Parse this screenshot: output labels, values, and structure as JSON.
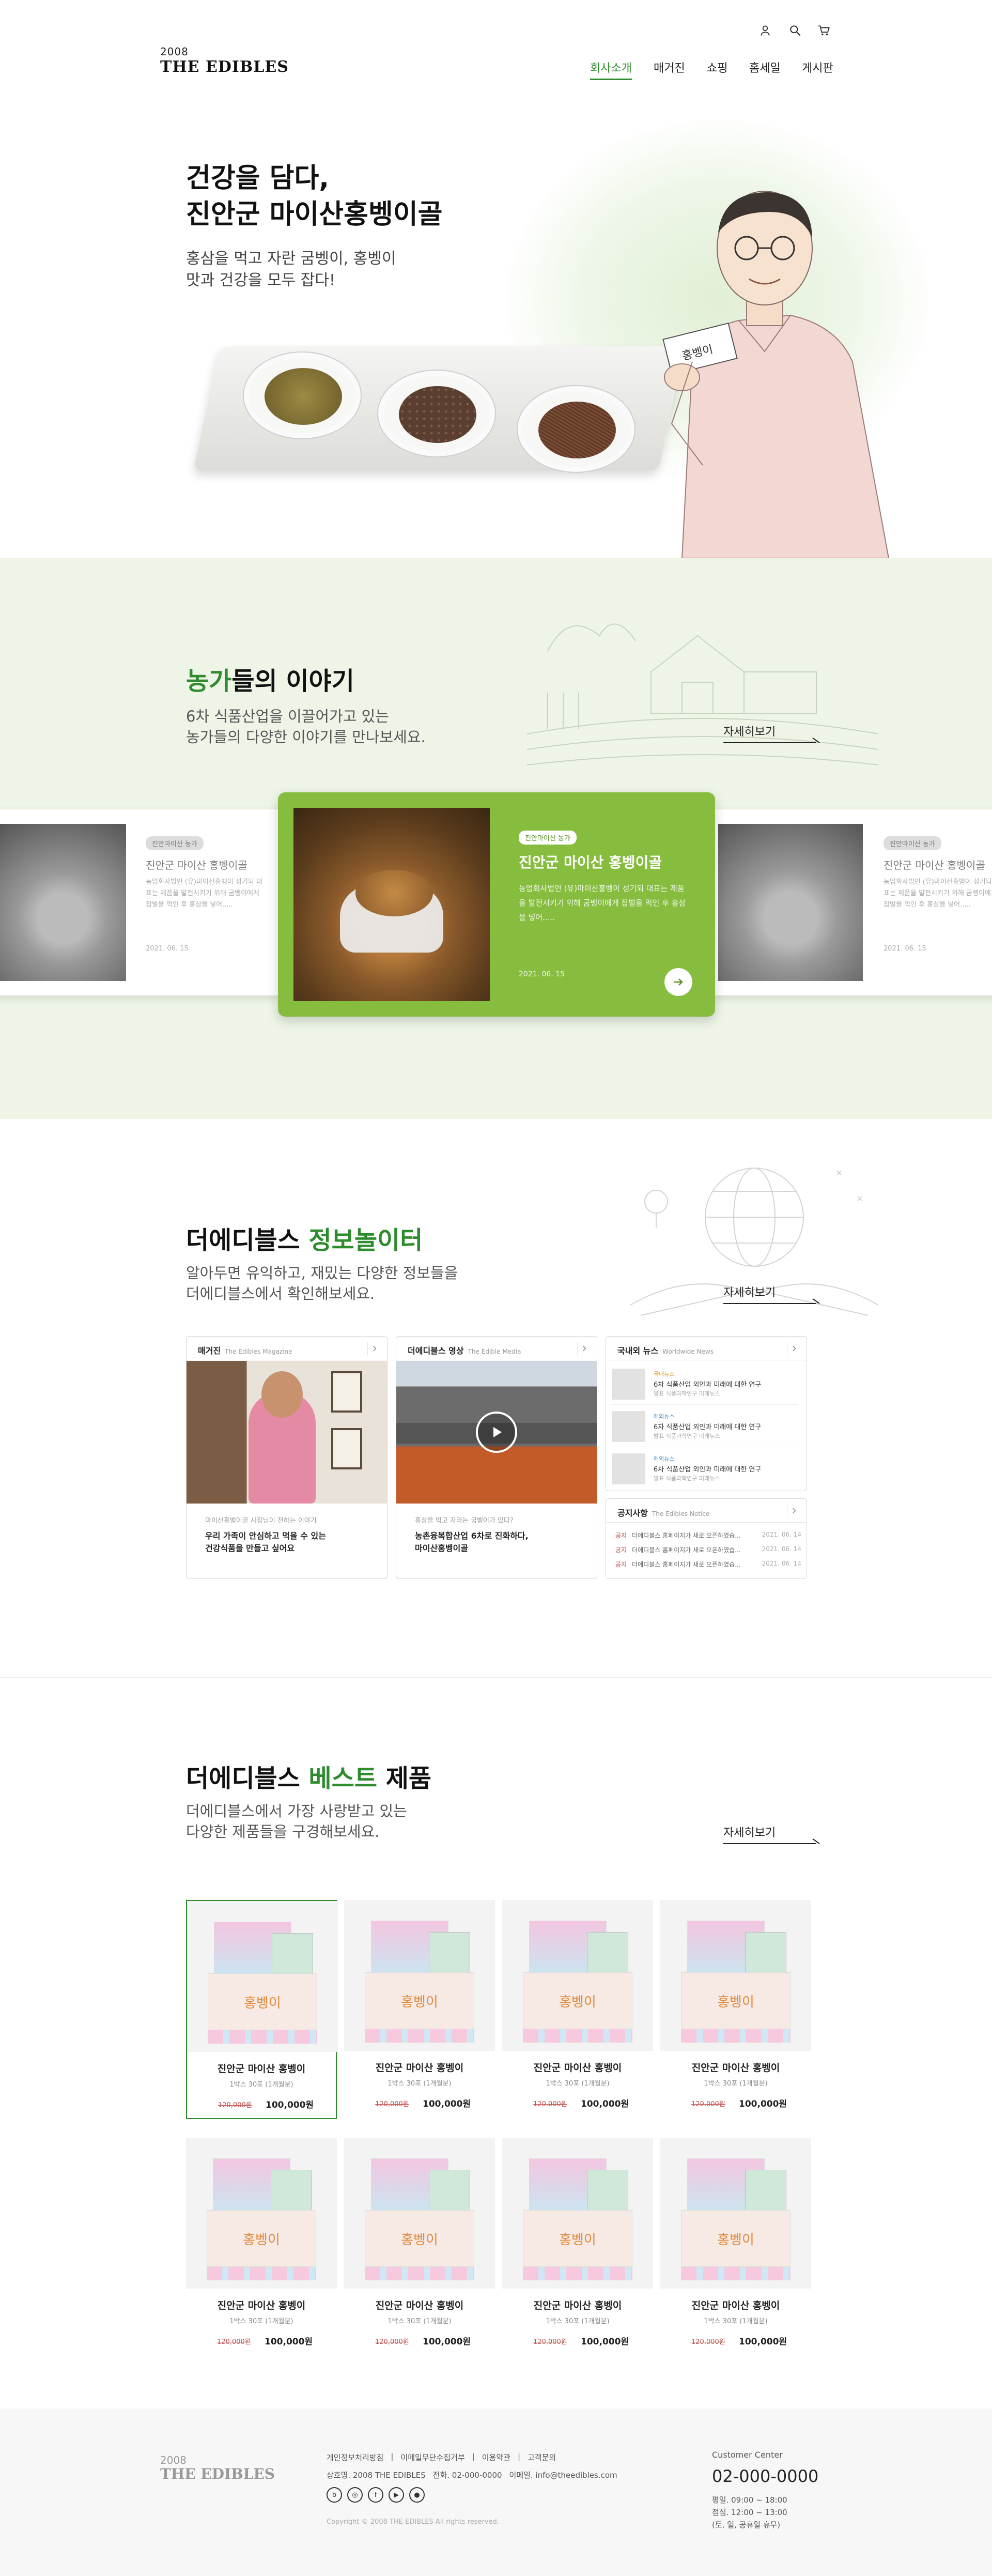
{
  "header": {
    "logo_year": "2008",
    "logo_name": "THE EDIBLES",
    "nav": [
      "회사소개",
      "매거진",
      "쇼핑",
      "홈세일",
      "게시판"
    ],
    "active_nav": "회사소개",
    "icons": [
      "user-icon",
      "search-icon",
      "cart-icon"
    ]
  },
  "hero": {
    "title_line1": "건강을 담다,",
    "title_line2": "진안군 마이산홍벵이골",
    "sub_line1": "홍삼을 먹고 자란 굼벵이, 홍벵이",
    "sub_line2": "맛과 건강을 모두 잡다!",
    "box_label": "홍벵이",
    "slide_count": 4,
    "active_slide": 2
  },
  "farmer": {
    "title_accent": "농가",
    "title_rest": "들의 이야기",
    "desc_line1": "6차 식품산업을 이끌어가고 있는",
    "desc_line2": "농가들의 다양한 이야기를 만나보세요.",
    "more": "자세히보기",
    "cards": [
      {
        "badge": "진안마이산 농가",
        "title": "진안군 마이산 홍벵이골",
        "body": "농업회사법인 (유)마이산홍벵이 성기되 대표는 제품을 발전시키기 위해 굼벵이에게 잡벌을 먹인 후 홍삼을 넣어.....",
        "date": "2021. 06. 15"
      },
      {
        "badge": "진안마이산 농가",
        "title": "진안군 마이산 홍벵이골",
        "body": "농업회사법인 (유)마이산홍벵이 성기되 대표는 제품을 발전시키기 위해 굼벵이에게 잡벌을 먹인 후 홍삼을 넣어.....",
        "date": "2021. 06. 15"
      },
      {
        "badge": "진안마이산 농가",
        "title": "진안군 마이산 홍벵이골",
        "body": "농업회사법인 (유)마이산홍벵이 성기되 대표는 제품을 발전시키기 위해 굼벵이에게 잡벌을 먹인 후 홍삼을 넣어.....",
        "date": "2021. 06. 15"
      }
    ]
  },
  "info": {
    "title_main": "더에디블스 ",
    "title_accent": "정보놀이터",
    "desc_line1": "알아두면 유익하고, 재밌는 다양한 정보들을",
    "desc_line2": "더에디블스에서 확인해보세요.",
    "more": "자세히보기",
    "magazine": {
      "title": "매거진",
      "sub": "The Edibles Magazine",
      "caption": "마이산홍벵이골 사장님이 전하는 이야기",
      "headline1": "우리 가족이 안심하고 먹을 수 있는",
      "headline2": "건강식품을 만들고 싶어요"
    },
    "video": {
      "title": "더에디블스 영상",
      "sub": "The Edible Media",
      "caption": "홍삼을 먹고 자라는 굼벵이가 있다?",
      "headline1": "농촌융복합산업 6차로 진화하다,",
      "headline2": "마이산홍벵이골"
    },
    "news": {
      "title": "국내외 뉴스",
      "sub": "Worldwide News",
      "items": [
        {
          "tag": "국내뉴스",
          "title": "6차 식품산업 외인과 미래에 대한 연구",
          "meta": "발표 식품과학연구 미래뉴스"
        },
        {
          "tag": "해외뉴스",
          "title": "6차 식품산업 외인과 미래에 대한 연구",
          "meta": "발표 식품과학연구 미래뉴스"
        },
        {
          "tag": "해외뉴스",
          "title": "6차 식품산업 외인과 미래에 대한 연구",
          "meta": "발표 식품과학연구 미래뉴스"
        }
      ]
    },
    "notice": {
      "title": "공지사항",
      "sub": "The Edibles Notice",
      "items": [
        {
          "tag": "공지",
          "text": "더에디블스 홈페이지가 새로 오픈하였습...",
          "date": "2021. 06. 14"
        },
        {
          "tag": "공지",
          "text": "더에디블스 홈페이지가 새로 오픈하였습...",
          "date": "2021. 06. 14"
        },
        {
          "tag": "공지",
          "text": "더에디블스 홈페이지가 새로 오픈하였습...",
          "date": "2021. 06. 14"
        }
      ]
    }
  },
  "best": {
    "title_main": "더에디블스 ",
    "title_accent": "베스트",
    "title_rest": " 제품",
    "desc_line1": "더에디블스에서 가장 사랑받고 있는",
    "desc_line2": "다양한 제품들을 구경해보세요.",
    "more": "자세히보기",
    "products": [
      {
        "name": "진안군 마이산 홍벵이",
        "spec": "1박스 30포 (1개월분)",
        "old_price": "120,000원",
        "price": "100,000원"
      },
      {
        "name": "진안군 마이산 홍벵이",
        "spec": "1박스 30포 (1개월분)",
        "old_price": "120,000원",
        "price": "100,000원"
      },
      {
        "name": "진안군 마이산 홍벵이",
        "spec": "1박스 30포 (1개월분)",
        "old_price": "120,000원",
        "price": "100,000원"
      },
      {
        "name": "진안군 마이산 홍벵이",
        "spec": "1박스 30포 (1개월분)",
        "old_price": "120,000원",
        "price": "100,000원"
      },
      {
        "name": "진안군 마이산 홍벵이",
        "spec": "1박스 30포 (1개월분)",
        "old_price": "120,000원",
        "price": "100,000원"
      },
      {
        "name": "진안군 마이산 홍벵이",
        "spec": "1박스 30포 (1개월분)",
        "old_price": "120,000원",
        "price": "100,000원"
      },
      {
        "name": "진안군 마이산 홍벵이",
        "spec": "1박스 30포 (1개월분)",
        "old_price": "120,000원",
        "price": "100,000원"
      },
      {
        "name": "진안군 마이산 홍벵이",
        "spec": "1박스 30포 (1개월분)",
        "old_price": "120,000원",
        "price": "100,000원"
      }
    ],
    "selected_index": 0
  },
  "footer": {
    "logo_year": "2008",
    "logo_name": "THE EDIBLES",
    "links": [
      "개인정보처리방침",
      "이메일무단수집거부",
      "이용약관",
      "고객문의"
    ],
    "company": "상호명. 2008 THE EDIBLES",
    "tel": "전화. 02-000-0000",
    "email": "이메일. info@theedibles.com",
    "copyright": "Copyright © 2008 THE EDIBLES All rights reserved.",
    "cs_title": "Customer Center",
    "cs_phone": "02-000-0000",
    "hours1": "평일. 09:00 ~ 18:00",
    "hours2": "점심. 12:00 ~ 13:00",
    "hours3": "(토, 일, 공휴일 휴무)",
    "sns": [
      "blog-icon",
      "instagram-icon",
      "facebook-icon",
      "youtube-icon",
      "kakao-icon"
    ]
  },
  "colors": {
    "accent": "#2e8b2e",
    "lime": "#86bd3f",
    "section_bg": "#eef5e7"
  }
}
